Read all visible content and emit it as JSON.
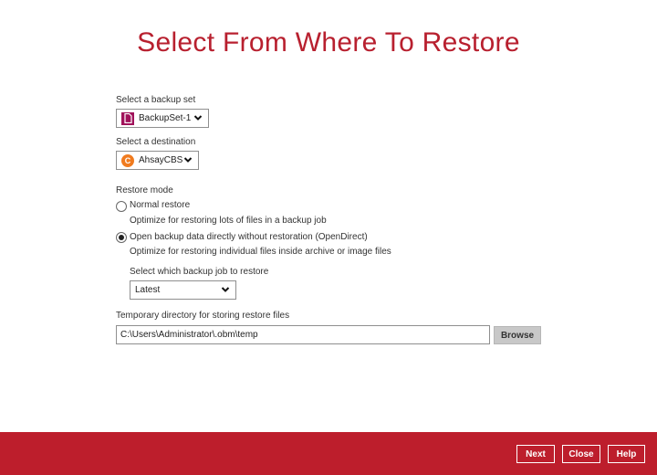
{
  "title": "Select From Where To Restore",
  "backup_set": {
    "label": "Select a backup set",
    "value": "BackupSet-1",
    "icon": "document-icon"
  },
  "destination": {
    "label": "Select a destination",
    "value": "AhsayCBS",
    "icon": "cbs-icon"
  },
  "restore_mode": {
    "label": "Restore mode",
    "options": [
      {
        "label": "Normal restore",
        "description": "Optimize for restoring lots of files in a backup job",
        "selected": false
      },
      {
        "label": "Open backup data directly without restoration (OpenDirect)",
        "description": "Optimize for restoring individual files inside archive or image files",
        "selected": true
      }
    ]
  },
  "backup_job": {
    "label": "Select which backup job to restore",
    "value": "Latest"
  },
  "temp_dir": {
    "label": "Temporary directory for storing restore files",
    "value": "C:\\Users\\Administrator\\.obm\\temp",
    "browse_label": "Browse"
  },
  "footer": {
    "next_label": "Next",
    "close_label": "Close",
    "help_label": "Help"
  },
  "colors": {
    "accent": "#b8202f",
    "footer_bg": "#bd1e2c",
    "backup_set_icon": "#a0125a",
    "destination_icon": "#f07b1f"
  }
}
